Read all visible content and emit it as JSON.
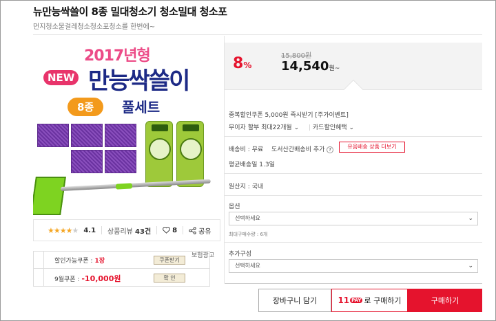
{
  "product": {
    "title": "뉴만능싹쓸이 8종 밀대청소기 청소밀대 청소포",
    "subtitle": "먼지청소물걸레청소청소포청소를 한번에~"
  },
  "image": {
    "year_badge": "2017년형",
    "new_tag": "NEW",
    "name": "만능싹쓸이",
    "count_tag": "8종",
    "set_label": "풀세트"
  },
  "rating": {
    "stars": "★★★★",
    "stars_empty": "★",
    "score": "4.1",
    "review_label": "상품리뷰",
    "review_count": "43건",
    "likes": "8",
    "share": "공유"
  },
  "coupons": {
    "ad_label": "보험광고",
    "row1": {
      "label": "할인가능쿠폰 :",
      "value": "1장",
      "button": "쿠폰받기"
    },
    "row2": {
      "label": "9월쿠폰 :",
      "value": "-10,000원",
      "button": "확    인"
    }
  },
  "price": {
    "discount": "8",
    "discount_unit": "%",
    "original": "15,800원",
    "sale": "14,540",
    "sale_unit": "원~"
  },
  "benefits": {
    "line1": "중복할인쿠폰 5,000원 즉시받기 [주가이벤트]",
    "installment": "무이자 할부 최대22개월",
    "card": "카드할인혜택"
  },
  "shipping": {
    "fee": "배송비 : 무료",
    "extra": "도서산간배송비 추가",
    "button": "유음배송 상품 더보기",
    "avg": "평균배송일 1.3일"
  },
  "origin": "원산지 : 국내",
  "options": {
    "label": "옵션",
    "select_placeholder": "선택하세요",
    "min_note": "최대구매수량 : 6개"
  },
  "addons": {
    "label": "추가구성",
    "select_placeholder": "선택하세요"
  },
  "actions": {
    "cart": "장바구니 담기",
    "pay_logo": "11",
    "pay_badge": "PAY",
    "pay_suffix": "로 구매하기",
    "buy": "구매하기"
  }
}
